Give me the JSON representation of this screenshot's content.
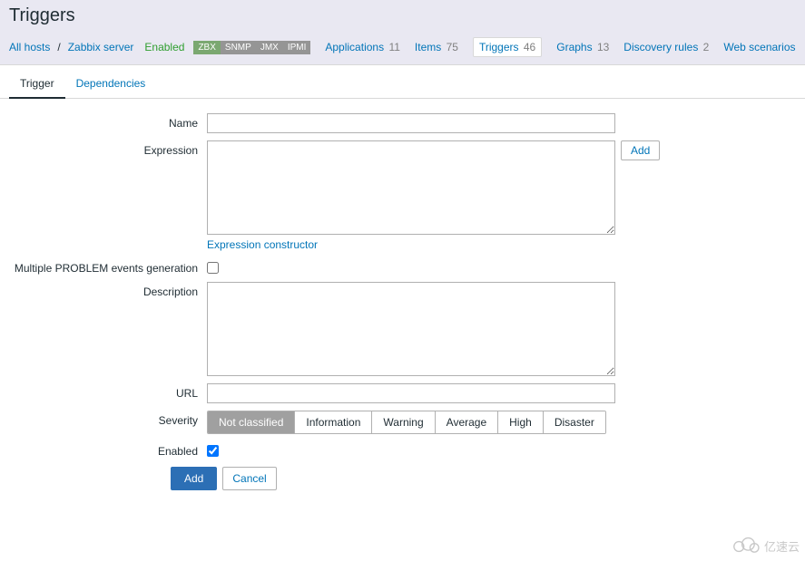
{
  "page": {
    "title": "Triggers"
  },
  "breadcrumb": {
    "all_hosts": "All hosts",
    "sep": "/",
    "host": "Zabbix server",
    "enabled": "Enabled"
  },
  "proto": {
    "zbx": "ZBX",
    "snmp": "SNMP",
    "jmx": "JMX",
    "ipmi": "IPMI"
  },
  "nav": {
    "applications": {
      "label": "Applications",
      "count": "11"
    },
    "items": {
      "label": "Items",
      "count": "75"
    },
    "triggers": {
      "label": "Triggers",
      "count": "46"
    },
    "graphs": {
      "label": "Graphs",
      "count": "13"
    },
    "discovery": {
      "label": "Discovery rules",
      "count": "2"
    },
    "web": {
      "label": "Web scenarios"
    }
  },
  "tabs": {
    "trigger": "Trigger",
    "dependencies": "Dependencies"
  },
  "form": {
    "name_label": "Name",
    "name_value": "",
    "expression_label": "Expression",
    "expression_value": "",
    "expression_add": "Add",
    "expression_constructor": "Expression constructor",
    "multiple_label": "Multiple PROBLEM events generation",
    "description_label": "Description",
    "description_value": "",
    "url_label": "URL",
    "url_value": "",
    "severity_label": "Severity",
    "severity": {
      "not_classified": "Not classified",
      "information": "Information",
      "warning": "Warning",
      "average": "Average",
      "high": "High",
      "disaster": "Disaster"
    },
    "enabled_label": "Enabled",
    "submit": "Add",
    "cancel": "Cancel"
  },
  "watermark": "亿速云"
}
